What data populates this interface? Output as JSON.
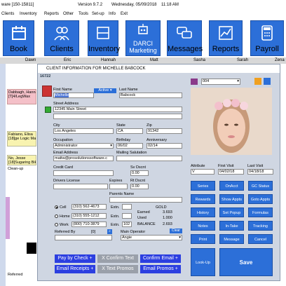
{
  "window": {
    "title_left": "ware [150-15811]",
    "version": "Version 9.7.2",
    "date": "Wednesday, 05/09/2018",
    "time": "11:18 AM"
  },
  "menu": [
    "Clients",
    "Inventory",
    "Reports",
    "Other",
    "Tools",
    "Set-up",
    "Info",
    "Exit"
  ],
  "toolbar": [
    {
      "label": "Book",
      "icon": "calendar-icon"
    },
    {
      "label": "Clients",
      "icon": "people-icon"
    },
    {
      "label": "Inventory",
      "icon": "shelf-icon"
    },
    {
      "label1": "DARCI",
      "label2": "Marketing",
      "icon": "robot-icon"
    },
    {
      "label": "Messages",
      "icon": "chat-icon"
    },
    {
      "label": "Reports",
      "icon": "chart-icon"
    },
    {
      "label": "Payroll",
      "icon": "calculator-icon"
    }
  ],
  "columns": [
    "Dawn",
    "Eric",
    "Hannah",
    "Matt",
    "Sasha",
    "Sarah",
    "Zena"
  ],
  "schedule": [
    {
      "text": "Dabbagh, Hanna\n[T]4/LegWax",
      "color": "#f4c0c8"
    },
    {
      "text": "Fabiano, Elisa\n[18]ge Logic Ma",
      "color": "#f8f3b0"
    },
    {
      "text": "No, Jesse\n[18]Sugaring Bik",
      "color": "#f8f3b0"
    },
    {
      "text": "Clean-up",
      "color": "#ffffff"
    },
    {
      "text": "Referred",
      "color": "#ffffff"
    }
  ],
  "dialog": {
    "title": "CLIENT INFORMATION FOR MICHELLE BABCOCK",
    "client_id": "16722",
    "first_name_label": "First Name",
    "first_name": "Michelle",
    "status": "Active",
    "last_name_label": "Last Name",
    "last_name": "Babcock",
    "street_label": "Street Address",
    "street": "12345 Main Street",
    "city_label": "City",
    "city": "Los Angeles",
    "state_label": "State",
    "state": "CA",
    "zip_label": "Zip",
    "zip": "91342",
    "occupation_label": "Occupation",
    "occupation": "Administrator",
    "birthday_label": "Birthday",
    "birthday": "06/02",
    "anniversary_label": "Anniversary",
    "anniversary": "02/14",
    "email_label": "Email Address",
    "email": "mattw@prosolutionssoftware.c",
    "salutation_label": "Mailing Salutation",
    "credit_label": "Credit Card",
    "sv_label": "Sv Dscnt",
    "sv": "0.00",
    "license_label": "Drivers License",
    "expires_label": "Expires",
    "rt_label": "Rt Dscnt",
    "rt": "0.00",
    "parents_label": "Parents Name",
    "cell_label": "Cell",
    "cell": "(310) 562-4673",
    "ext_label": "Extn.",
    "home_label": "Home",
    "home": "(310) 555-1212",
    "work_label": "Work",
    "work": "(800) 710-3879",
    "work_ext": "102",
    "gold_label": "GOLD",
    "earned_label": "Earned",
    "earned": "3.693",
    "used_label": "Used",
    "used": "1.000",
    "balance_label": "BALANCE",
    "balance": "2.693",
    "referred_label": "Referred By",
    "ref_num": "[0]",
    "operator_label": "Main Operator",
    "clear": "Clear",
    "operator": "Angie",
    "combo": "004",
    "attribute_label": "Attribute",
    "attribute": "V",
    "first_visit_label": "First Visit",
    "first_visit": "04/02/18",
    "last_visit_label": "Last Visit",
    "last_visit": "04/18/18"
  },
  "side_buttons": [
    "Series",
    "OnAcct",
    "GC Status",
    "Rewards",
    "Show Appts",
    "Goto Appts",
    "History",
    "Set Popup",
    "Formulas",
    "Notes",
    "In-Take",
    "Tracking",
    "Print",
    "Message",
    "Cancel"
  ],
  "lookup": "Look-Up",
  "save": "Save",
  "bottom_buttons": [
    {
      "label": "Pay by Check +",
      "type": "blue"
    },
    {
      "label": "X Confirm Text",
      "type": "gray"
    },
    {
      "label": "Confirm Email +",
      "type": "blue"
    },
    {
      "label": "Email Receipts +",
      "type": "blue"
    },
    {
      "label": "X Text Promos",
      "type": "gray"
    },
    {
      "label": "Email Promos +",
      "type": "blue"
    }
  ]
}
